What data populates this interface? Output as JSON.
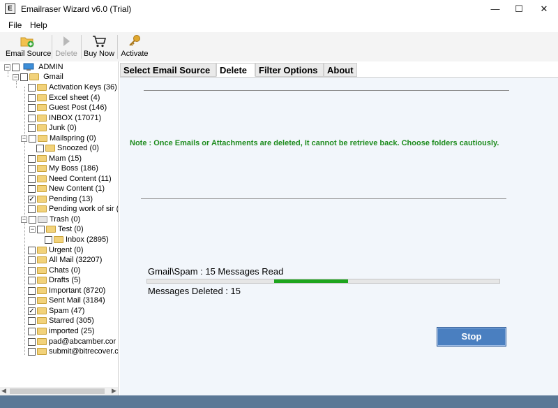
{
  "window": {
    "title": "Emailraser Wizard v6.0 (Trial)",
    "app_icon_text": "E",
    "min": "—",
    "max": "☐",
    "close": "✕"
  },
  "menu": {
    "file": "File",
    "help": "Help"
  },
  "toolbar": {
    "email_source": "Email Source",
    "delete": "Delete",
    "buy_now": "Buy Now",
    "activate": "Activate"
  },
  "tree": {
    "root": "ADMIN",
    "account": "Gmail",
    "folders": [
      {
        "label": "Activation Keys (36)",
        "checked": false
      },
      {
        "label": "Excel sheet (4)",
        "checked": false
      },
      {
        "label": "Guest Post (146)",
        "checked": false
      },
      {
        "label": "INBOX (17071)",
        "checked": false
      },
      {
        "label": "Junk (0)",
        "checked": false
      },
      {
        "label": "Mailspring (0)",
        "checked": false
      },
      {
        "label": "Snoozed (0)",
        "checked": false
      },
      {
        "label": "Mam (15)",
        "checked": false
      },
      {
        "label": "My Boss (186)",
        "checked": false
      },
      {
        "label": "Need Content (11)",
        "checked": false
      },
      {
        "label": "New Content (1)",
        "checked": false
      },
      {
        "label": "Pending (13)",
        "checked": true
      },
      {
        "label": "Pending work of sir (2",
        "checked": false
      },
      {
        "label": "Trash (0)",
        "checked": false
      },
      {
        "label": "Test (0)",
        "checked": false
      },
      {
        "label": "Inbox (2895)",
        "checked": false
      },
      {
        "label": "Urgent (0)",
        "checked": false
      },
      {
        "label": "All Mail (32207)",
        "checked": false
      },
      {
        "label": "Chats (0)",
        "checked": false
      },
      {
        "label": "Drafts (5)",
        "checked": false
      },
      {
        "label": "Important (8720)",
        "checked": false
      },
      {
        "label": "Sent Mail (3184)",
        "checked": false
      },
      {
        "label": "Spam (47)",
        "checked": true
      },
      {
        "label": "Starred (305)",
        "checked": false
      },
      {
        "label": "imported (25)",
        "checked": false
      },
      {
        "label": "pad@abcamber.cor",
        "checked": false
      },
      {
        "label": "submit@bitrecover.c",
        "checked": false
      }
    ]
  },
  "tabs": {
    "select_email_source": "Select Email Source",
    "delete": "Delete",
    "filter_options": "Filter Options",
    "about": "About"
  },
  "main": {
    "note": "Note : Once Emails or Attachments are deleted, It cannot be retrieve back. Choose folders cautiously.",
    "status_read": "Gmail\\Spam : 15 Messages Read",
    "status_deleted": "Messages Deleted : 15",
    "progress": {
      "start_fraction": 0.36,
      "end_fraction": 0.57,
      "color": "#1ea51e"
    },
    "stop_button": "Stop"
  },
  "colors": {
    "accent": "#4a7fc0",
    "note_green": "#1e8c1e",
    "statusbar": "#5b7896"
  }
}
